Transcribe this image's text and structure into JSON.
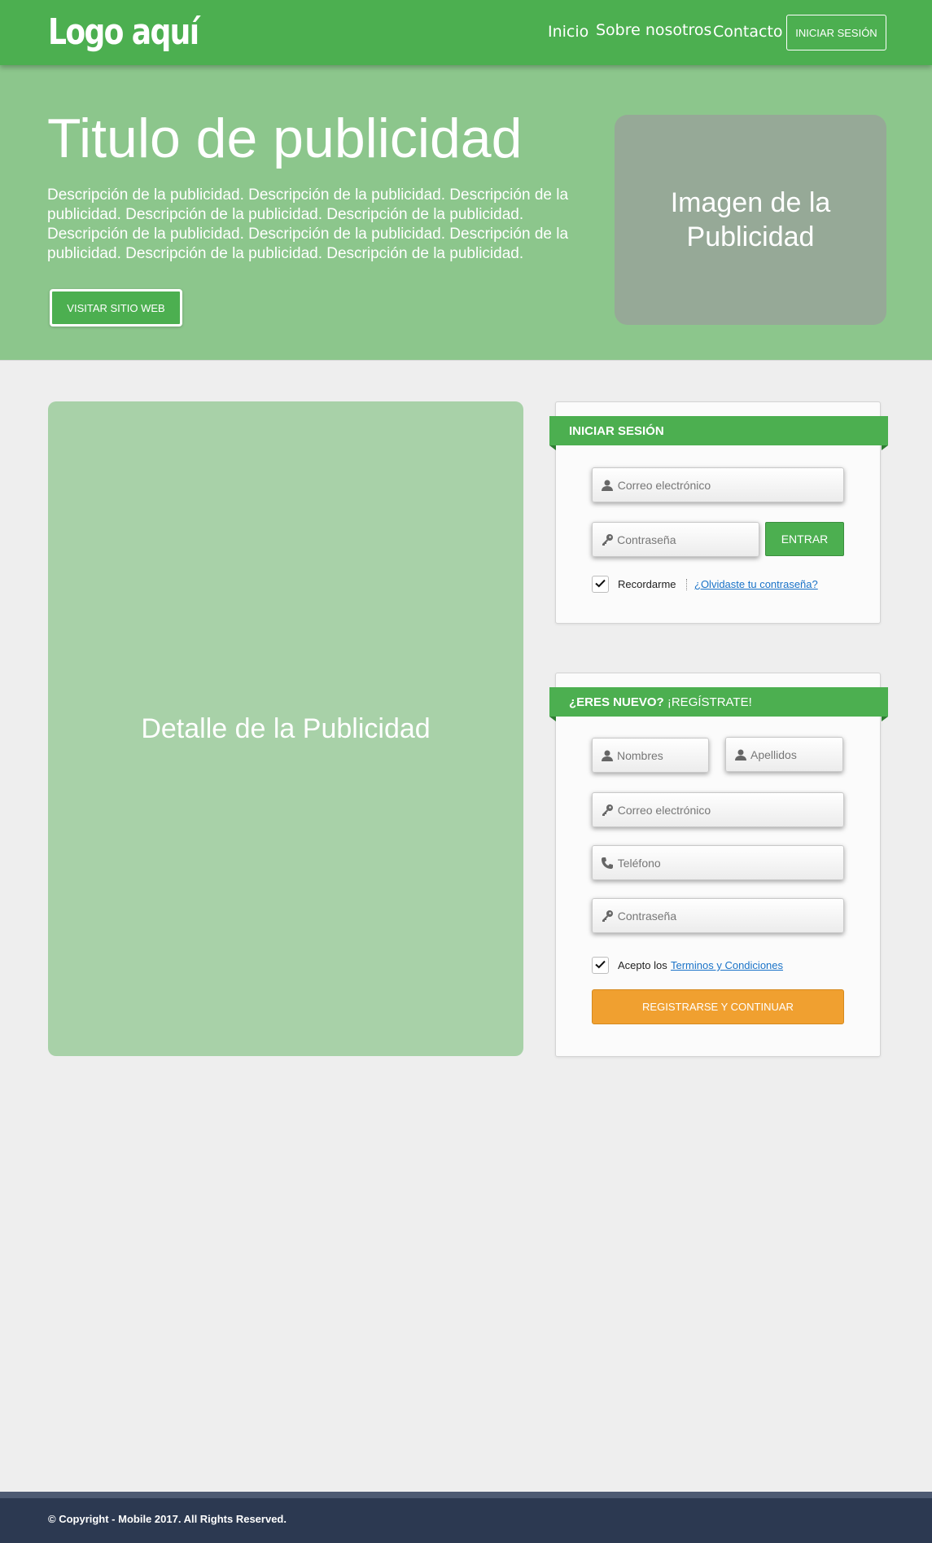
{
  "header": {
    "logo": "Logo aquí",
    "nav": [
      "Inicio",
      "Sobre nosotros",
      "Contacto"
    ],
    "login_button": "INICIAR SESIÓN"
  },
  "hero": {
    "title": "Titulo de publicidad",
    "description": "Descripción de la publicidad. Descripción de la publicidad. Descripción de la publicidad. Descripción de la publicidad. Descripción de la publicidad. Descripción de la publicidad. Descripción de la publicidad. Descripción de la publicidad. Descripción de la publicidad. Descripción de la publicidad.",
    "visit_button": "VISITAR SITIO WEB",
    "image_placeholder": "Imagen de la Publicidad"
  },
  "detail": {
    "placeholder": "Detalle de la Publicidad"
  },
  "login": {
    "title": "INICIAR SESIÓN",
    "email_placeholder": "Correo electrónico",
    "password_placeholder": "Contraseña",
    "submit": "ENTRAR",
    "remember_label": "Recordarme",
    "remember_checked": true,
    "forgot_link": "¿Olvidaste tu contraseña?"
  },
  "register": {
    "title_bold": "¿ERES NUEVO?",
    "title_light": "¡REGÍSTRATE!",
    "names_placeholder": "Nombres",
    "lastnames_placeholder": "Apellidos",
    "email_placeholder": "Correo electrónico",
    "phone_placeholder": "Teléfono",
    "password_placeholder": "Contraseña",
    "accept_prefix": "Acepto los",
    "accept_checked": true,
    "terms_link": "Terminos y Condiciones",
    "submit": "REGISTRARSE Y CONTINUAR"
  },
  "footer": {
    "copyright": "© Copyright - Mobile 2017. All Rights Reserved."
  },
  "colors": {
    "primary_green": "#4caf50",
    "hero_green": "#8cc68c",
    "detail_green": "#a8d1a8",
    "image_gray": "#96a997",
    "register_orange": "#f0a030",
    "footer_navy": "#2c3951",
    "link_blue": "#1a73c8",
    "page_background": "#eeeeee"
  }
}
